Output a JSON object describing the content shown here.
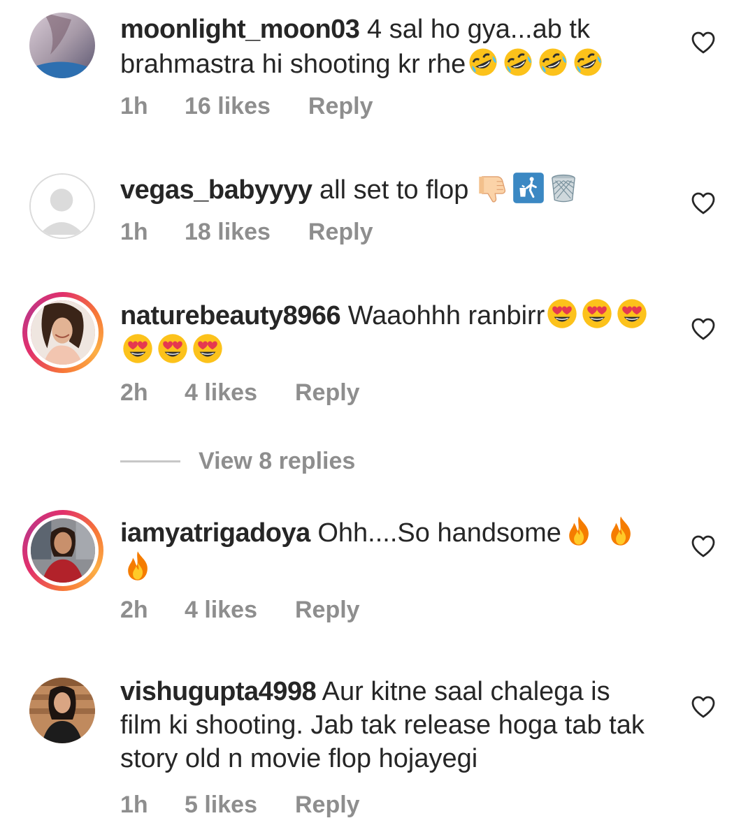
{
  "comments": [
    {
      "username": "moonlight_moon03",
      "text": " 4 sal ho gya...ab tk brahmastra hi shooting kr rhe",
      "emojis": [
        "rofl-emoji",
        "rofl-emoji",
        "rofl-emoji",
        "rofl-emoji"
      ],
      "time": "1h",
      "likes": "16 likes",
      "reply": "Reply"
    },
    {
      "username": "vegas_babyyyy",
      "text": " all set to flop ",
      "emojis": [
        "thumbs-down-emoji",
        "litter-bin-sign-emoji",
        "wastebasket-emoji"
      ],
      "time": "1h",
      "likes": "18 likes",
      "reply": "Reply"
    },
    {
      "username": "naturebeauty8966",
      "text": " Waaohhh ranbirr",
      "emojis": [
        "heart-eyes-emoji",
        "heart-eyes-emoji",
        "heart-eyes-emoji",
        "heart-eyes-emoji",
        "heart-eyes-emoji",
        "heart-eyes-emoji"
      ],
      "time": "2h",
      "likes": "4 likes",
      "reply": "Reply",
      "view_replies": "View 8 replies"
    },
    {
      "username": "iamyatrigadoya",
      "text": " Ohh....So handsome",
      "emojis": [
        "fire-emoji",
        "fire-emoji",
        "fire-emoji"
      ],
      "time": "2h",
      "likes": "4 likes",
      "reply": "Reply"
    },
    {
      "username": "vishugupta4998",
      "text": " Aur kitne saal chalega is film ki shooting. Jab tak release hoga tab tak story old n movie flop hojayegi",
      "emojis": [],
      "time": "1h",
      "likes": "5 likes",
      "reply": "Reply"
    }
  ],
  "colors": {
    "text": "#262626",
    "meta": "#8e8e8e",
    "story_ring_start": "#f77737",
    "story_ring_end": "#e1306c"
  },
  "icons": {
    "like": "heart-outline-icon"
  }
}
